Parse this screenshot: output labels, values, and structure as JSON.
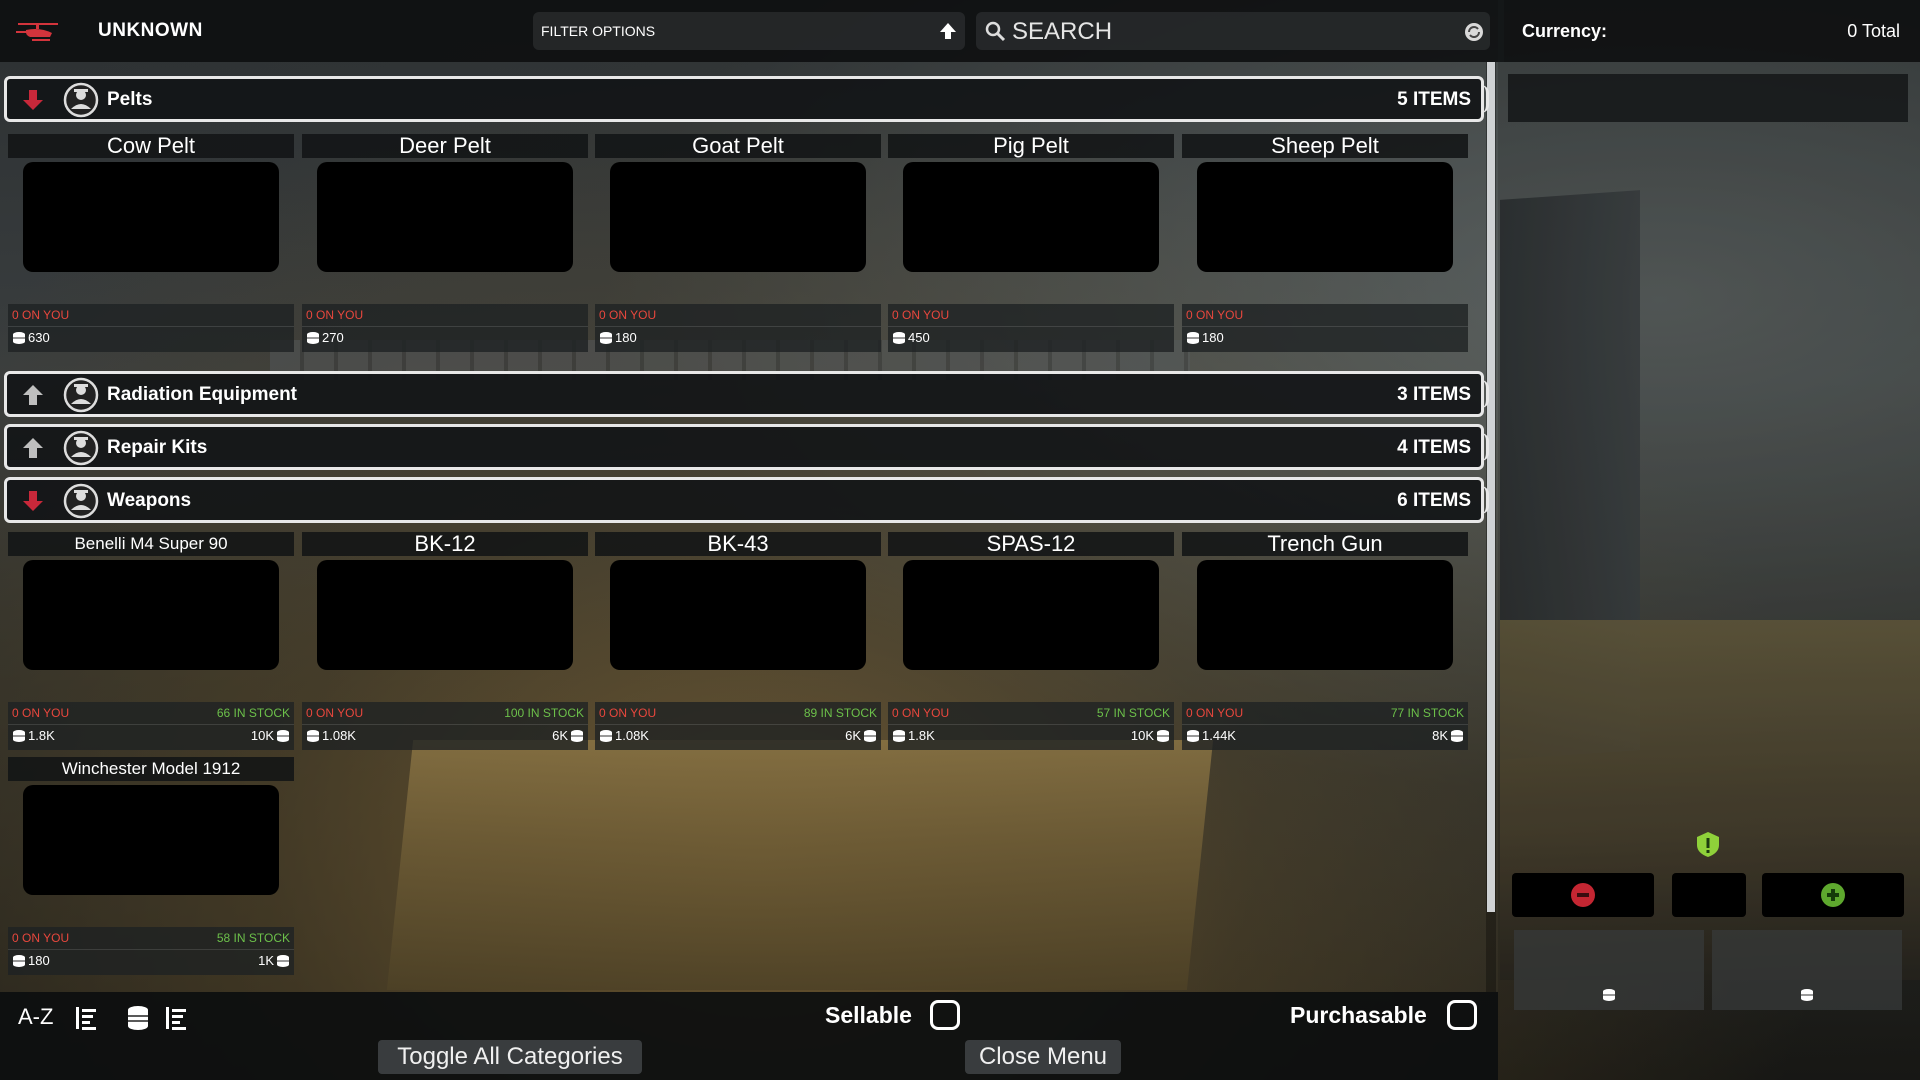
{
  "header": {
    "title": "UNKNOWN",
    "filter_label": "FILTER OPTIONS",
    "search_placeholder": "SEARCH"
  },
  "currency": {
    "label": "Currency:",
    "total": "0 Total"
  },
  "categories": [
    {
      "name": "Pelts",
      "count": "5 ITEMS",
      "expanded": true,
      "items": [
        {
          "name": "Cow Pelt",
          "on_you": "0 ON YOU",
          "stock": "",
          "buy": "630",
          "sell": ""
        },
        {
          "name": "Deer Pelt",
          "on_you": "0 ON YOU",
          "stock": "",
          "buy": "270",
          "sell": ""
        },
        {
          "name": "Goat Pelt",
          "on_you": "0 ON YOU",
          "stock": "",
          "buy": "180",
          "sell": ""
        },
        {
          "name": "Pig Pelt",
          "on_you": "0 ON YOU",
          "stock": "",
          "buy": "450",
          "sell": ""
        },
        {
          "name": "Sheep Pelt",
          "on_you": "0 ON YOU",
          "stock": "",
          "buy": "180",
          "sell": ""
        }
      ]
    },
    {
      "name": "Radiation Equipment",
      "count": "3 ITEMS",
      "expanded": false
    },
    {
      "name": "Repair Kits",
      "count": "4 ITEMS",
      "expanded": false
    },
    {
      "name": "Weapons",
      "count": "6 ITEMS",
      "expanded": true,
      "items": [
        {
          "name": "Benelli M4 Super 90",
          "on_you": "0 ON YOU",
          "stock": "66 IN STOCK",
          "buy": "1.8K",
          "sell": "10K"
        },
        {
          "name": "BK-12",
          "on_you": "0 ON YOU",
          "stock": "100 IN STOCK",
          "buy": "1.08K",
          "sell": "6K"
        },
        {
          "name": "BK-43",
          "on_you": "0 ON YOU",
          "stock": "89 IN STOCK",
          "buy": "1.08K",
          "sell": "6K"
        },
        {
          "name": "SPAS-12",
          "on_you": "0 ON YOU",
          "stock": "57 IN STOCK",
          "buy": "1.8K",
          "sell": "10K"
        },
        {
          "name": "Trench Gun",
          "on_you": "0 ON YOU",
          "stock": "77 IN STOCK",
          "buy": "1.44K",
          "sell": "8K"
        },
        {
          "name": "Winchester Model 1912",
          "on_you": "0 ON YOU",
          "stock": "58 IN STOCK",
          "buy": "180",
          "sell": "1K"
        }
      ]
    }
  ],
  "footer": {
    "sort_label": "A-Z",
    "sellable_label": "Sellable",
    "purchasable_label": "Purchasable",
    "toggle_label": "Toggle All Categories",
    "close_label": "Close Menu"
  },
  "colors": {
    "on_you": "#e8473d",
    "in_stock": "#6cc04a",
    "expand_arrow": "#c8283a",
    "collapse_arrow": "#bfbfbf"
  },
  "icons": {
    "logo": "helicopter-icon",
    "filter": "arrow-up-icon",
    "search": "magnifier-icon",
    "refresh": "refresh-icon",
    "category": "trader-badge-icon",
    "coin": "coin-stack-icon",
    "warning": "warning-icon",
    "minus": "minus-icon",
    "plus": "plus-icon"
  }
}
